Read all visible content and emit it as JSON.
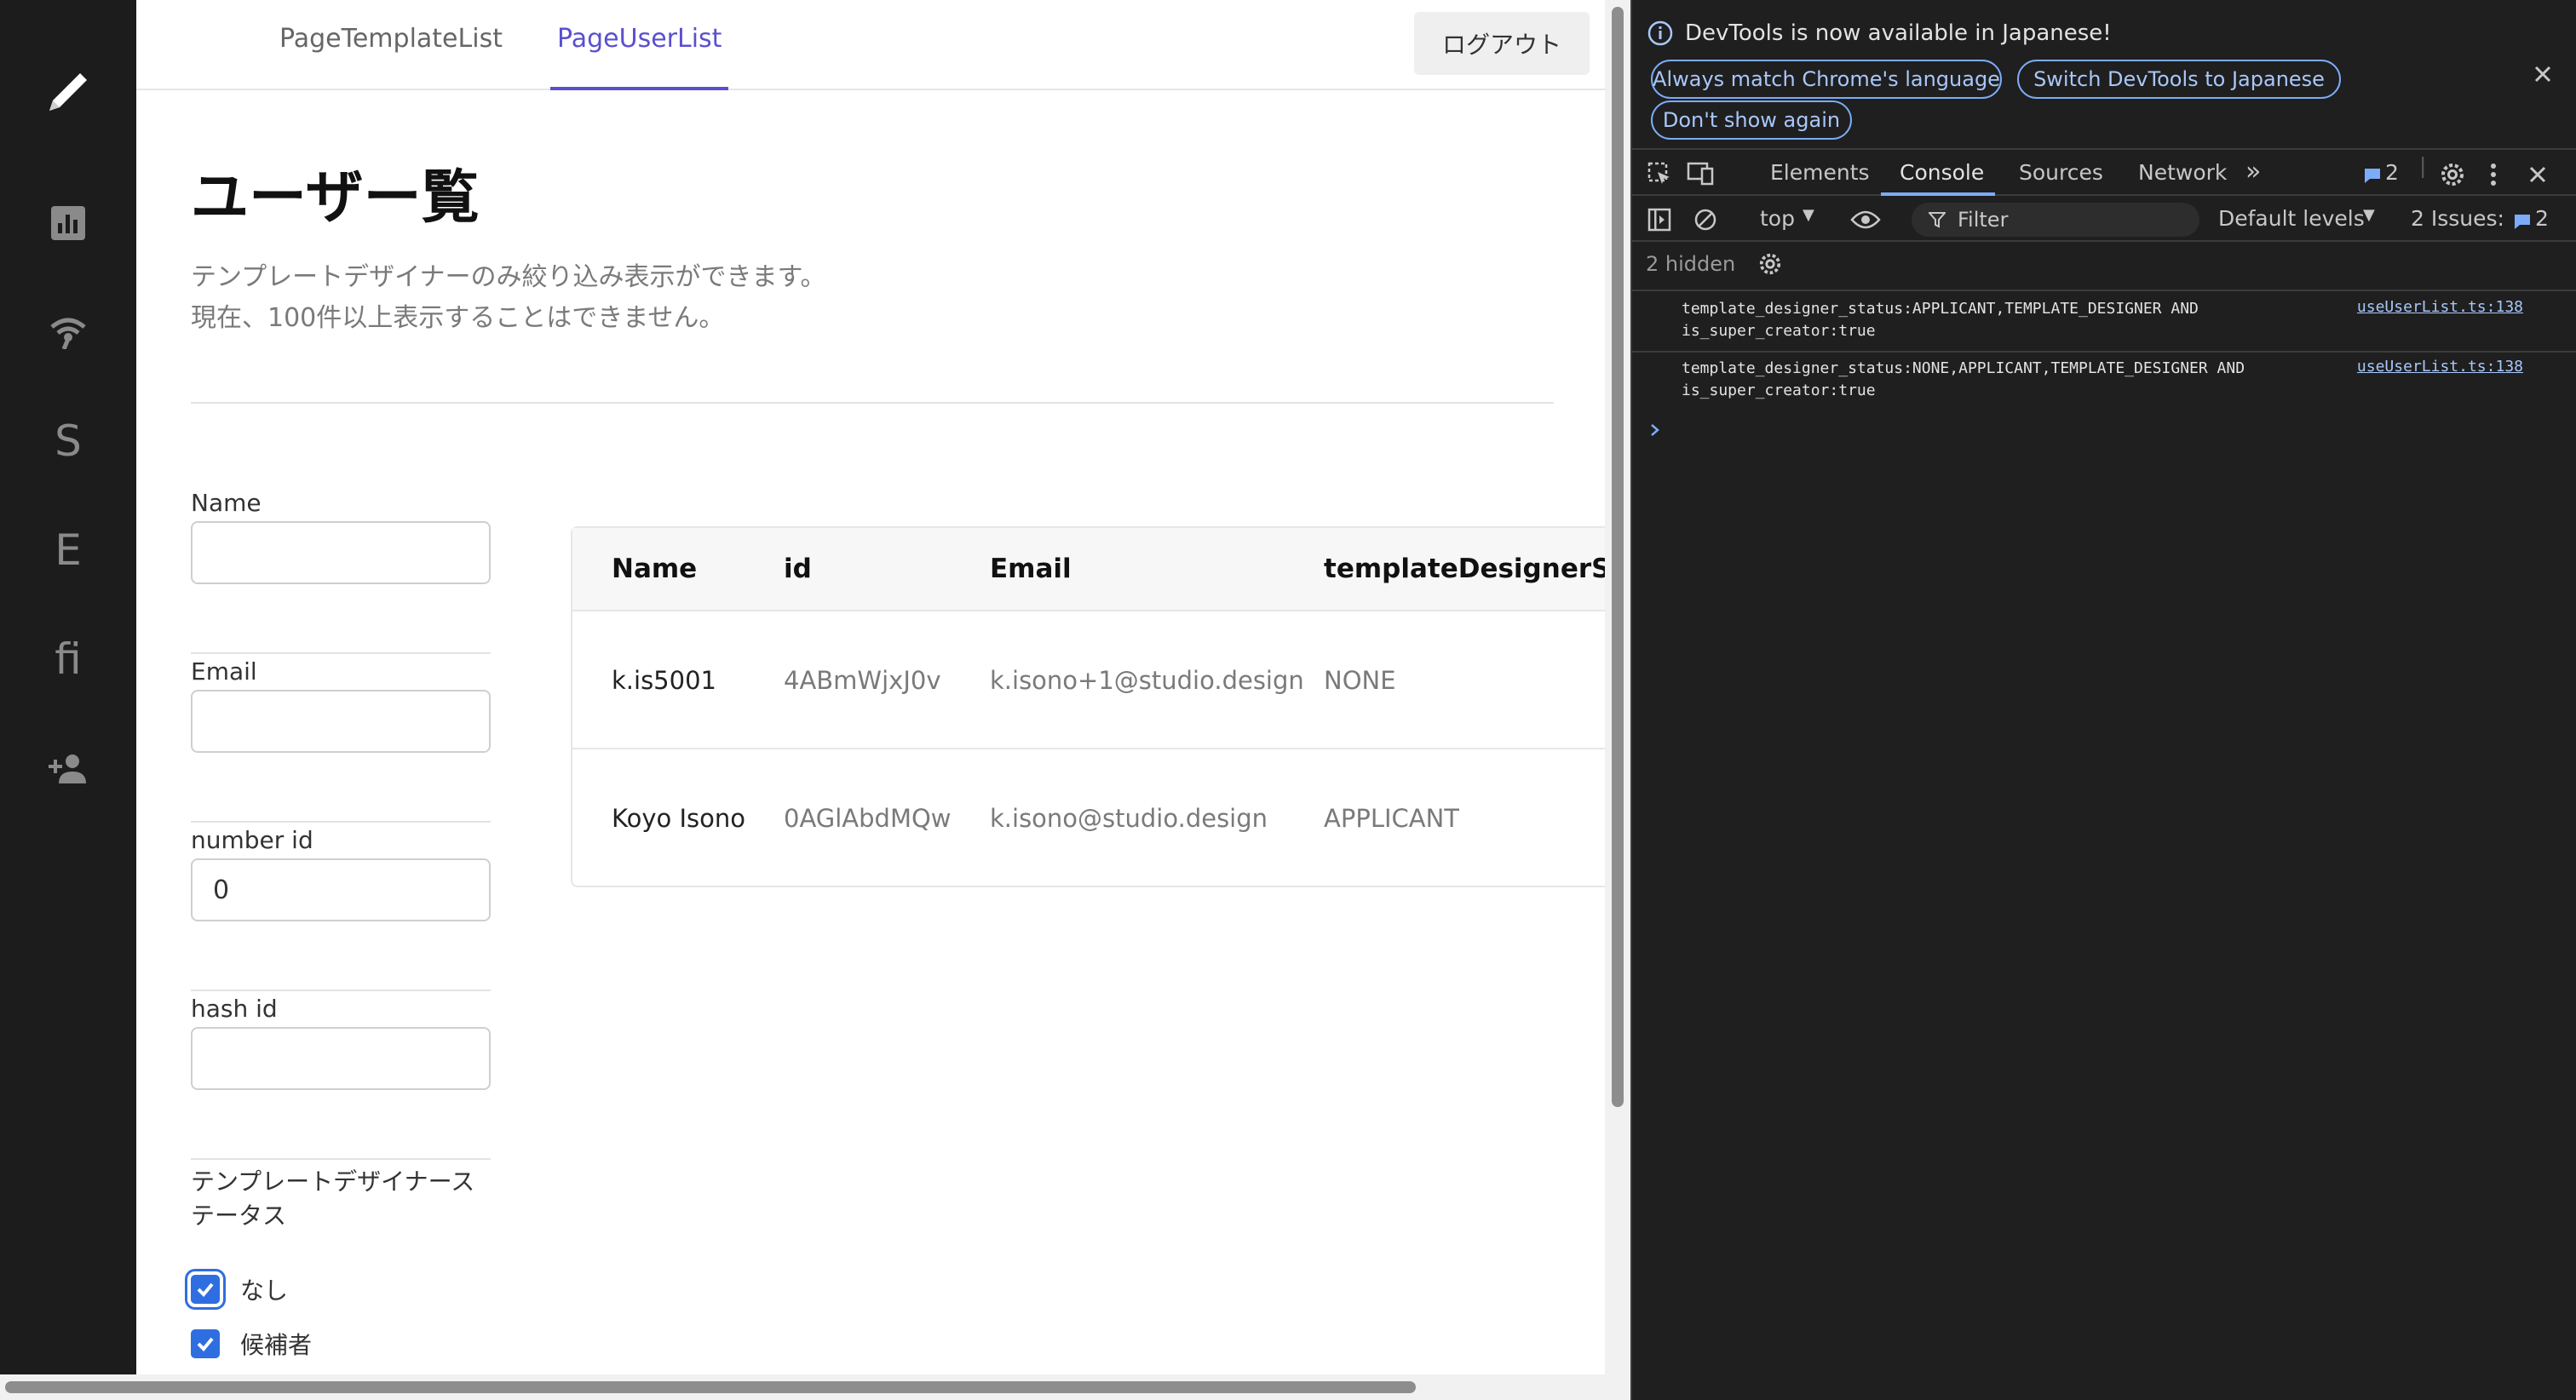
{
  "sidebar": {
    "items": [
      {
        "icon": "pencil-icon"
      },
      {
        "icon": "bar-chart-icon"
      },
      {
        "icon": "broadcast-icon"
      },
      {
        "label": "S"
      },
      {
        "label": "E"
      },
      {
        "label": "fi"
      },
      {
        "icon": "person-add-icon"
      }
    ]
  },
  "nav": {
    "tabs": [
      {
        "label": "PageTemplateList"
      },
      {
        "label": "PageUserList"
      }
    ],
    "logout_label": "ログアウト"
  },
  "page": {
    "title": "ユーザー覧",
    "description_line1": "テンプレートデザイナーのみ絞り込み表示ができます。",
    "description_line2": "現在、100件以上表示することはできません。"
  },
  "filters": {
    "name": {
      "label": "Name",
      "value": ""
    },
    "email": {
      "label": "Email",
      "value": ""
    },
    "number_id": {
      "label": "number id",
      "value": "0"
    },
    "hash_id": {
      "label": "hash id",
      "value": ""
    },
    "status_label_line1": "テンプレートデザイナース",
    "status_label_line2": "テータス",
    "status_options": [
      {
        "label": "なし",
        "checked": true
      },
      {
        "label": "候補者",
        "checked": true
      }
    ]
  },
  "table": {
    "headers": [
      "Name",
      "id",
      "Email",
      "templateDesignerStat"
    ],
    "rows": [
      [
        "k.is5001",
        "4ABmWjxJ0v",
        "k.isono+1@studio.design",
        "NONE"
      ],
      [
        "Koyo Isono",
        "0AGlAbdMQw",
        "k.isono@studio.design",
        "APPLICANT"
      ]
    ]
  },
  "devtools": {
    "banner_text": "DevTools is now available in Japanese!",
    "banner_buttons": [
      "Always match Chrome's language",
      "Switch DevTools to Japanese",
      "Don't show again"
    ],
    "tabs": [
      "Elements",
      "Console",
      "Sources",
      "Network"
    ],
    "active_tab": "Console",
    "message_count": "2",
    "context": "top",
    "filter_placeholder": "Filter",
    "levels": "Default levels",
    "issues_label": "2 Issues:",
    "issues_count": "2",
    "hidden_label": "2 hidden",
    "logs": [
      {
        "line1": "template_designer_status:APPLICANT,TEMPLATE_DESIGNER AND",
        "line2": "is_super_creator:true",
        "source": "useUserList.ts:138"
      },
      {
        "line1": "template_designer_status:NONE,APPLICANT,TEMPLATE_DESIGNER AND",
        "line2": "is_super_creator:true",
        "source": "useUserList.ts:138"
      }
    ],
    "colors": {
      "background": "#1f1f1f",
      "accent": "#7cacf8",
      "link": "#a8c7fa"
    }
  },
  "colors": {
    "sidebar": "#1c1c1c",
    "accent": "#5b4fcf",
    "checkbox": "#2f6ee0"
  }
}
